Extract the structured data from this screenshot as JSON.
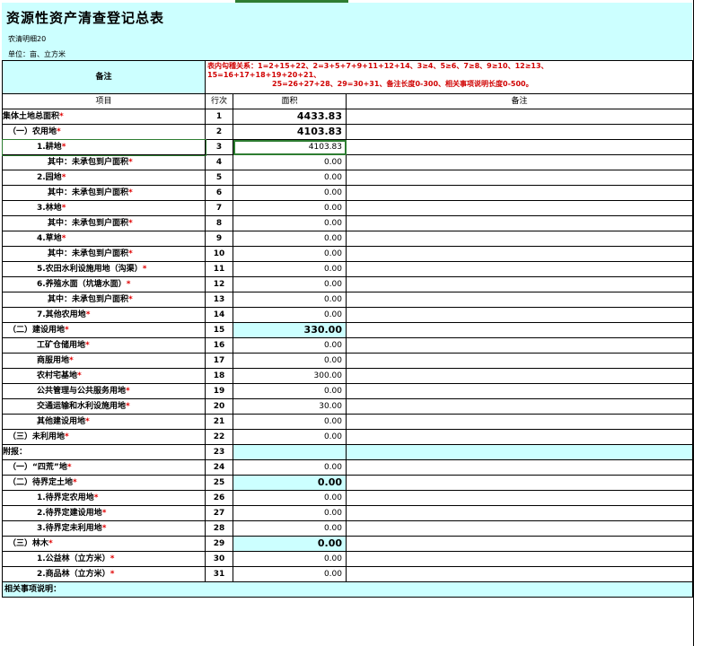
{
  "title": "资源性资产清查登记总表",
  "subtitle": "农清明细20",
  "unit": "单位：亩、立方米",
  "remark_label": "备注",
  "rules_line1": "表内勾稽关系：1=2+15+22、2=3+5+7+9+11+12+14、3≥4、5≥6、7≥8、9≥10、12≥13、",
  "rules_line2": "15=16+17+18+19+20+21、",
  "rules_line3": "25=26+27+28、29=30+31、备注长度0-300、相关事项说明长度0-500。",
  "columns": {
    "item": "项目",
    "line": "行次",
    "area": "面积",
    "note": "备注"
  },
  "rows": [
    {
      "label": "集体土地总面积",
      "star": "*",
      "line": "1",
      "value": "4433.83"
    },
    {
      "label": "（一）农用地",
      "star": "*",
      "line": "2",
      "value": "4103.83"
    },
    {
      "label": "1.耕地",
      "star": "*",
      "line": "3",
      "value": "4103.83"
    },
    {
      "label": "其中：未承包到户面积",
      "star": "*",
      "line": "4",
      "value": "0.00"
    },
    {
      "label": "2.园地",
      "star": "*",
      "line": "5",
      "value": "0.00"
    },
    {
      "label": "其中：未承包到户面积",
      "star": "*",
      "line": "6",
      "value": "0.00"
    },
    {
      "label": "3.林地",
      "star": "*",
      "line": "7",
      "value": "0.00"
    },
    {
      "label": "其中：未承包到户面积",
      "star": "*",
      "line": "8",
      "value": "0.00"
    },
    {
      "label": "4.草地",
      "star": "*",
      "line": "9",
      "value": "0.00"
    },
    {
      "label": "其中：未承包到户面积",
      "star": "*",
      "line": "10",
      "value": "0.00"
    },
    {
      "label": "5.农田水利设施用地（沟渠）",
      "star": "*",
      "line": "11",
      "value": "0.00"
    },
    {
      "label": "6.养殖水面（坑塘水面）",
      "star": "*",
      "line": "12",
      "value": "0.00"
    },
    {
      "label": "其中：未承包到户面积",
      "star": "*",
      "line": "13",
      "value": "0.00"
    },
    {
      "label": "7.其他农用地",
      "star": "*",
      "line": "14",
      "value": "0.00"
    },
    {
      "label": "（二）建设用地",
      "star": "*",
      "line": "15",
      "value": "330.00"
    },
    {
      "label": "工矿仓储用地",
      "star": "*",
      "line": "16",
      "value": "0.00"
    },
    {
      "label": "商服用地",
      "star": "*",
      "line": "17",
      "value": "0.00"
    },
    {
      "label": "农村宅基地",
      "star": "*",
      "line": "18",
      "value": "300.00"
    },
    {
      "label": "公共管理与公共服务用地",
      "star": "*",
      "line": "19",
      "value": "0.00"
    },
    {
      "label": "交通运输和水利设施用地",
      "star": "*",
      "line": "20",
      "value": "30.00"
    },
    {
      "label": "其他建设用地",
      "star": "*",
      "line": "21",
      "value": "0.00"
    },
    {
      "label": "（三）未利用地",
      "star": "*",
      "line": "22",
      "value": "0.00"
    },
    {
      "label": "附报：",
      "star": "",
      "line": "23",
      "value": ""
    },
    {
      "label": "（一）“四荒”地",
      "star": "*",
      "line": "24",
      "value": "0.00"
    },
    {
      "label": "（二）待界定土地",
      "star": "*",
      "line": "25",
      "value": "0.00"
    },
    {
      "label": "1.待界定农用地",
      "star": "*",
      "line": "26",
      "value": "0.00"
    },
    {
      "label": "2.待界定建设用地",
      "star": "*",
      "line": "27",
      "value": "0.00"
    },
    {
      "label": "3.待界定未利用地",
      "star": "*",
      "line": "28",
      "value": "0.00"
    },
    {
      "label": "（三）林木",
      "star": "*",
      "line": "29",
      "value": "0.00"
    },
    {
      "label": "1.公益林（立方米）",
      "star": "*",
      "line": "30",
      "value": "0.00"
    },
    {
      "label": "2.商品林（立方米）",
      "star": "*",
      "line": "31",
      "value": "0.00"
    }
  ],
  "footer_label": "相关事项说明：",
  "colors": {
    "header_bg": "#ccffff",
    "required_star": "#e00000",
    "rule_text": "#d00000",
    "selection": "#2e7d32"
  }
}
